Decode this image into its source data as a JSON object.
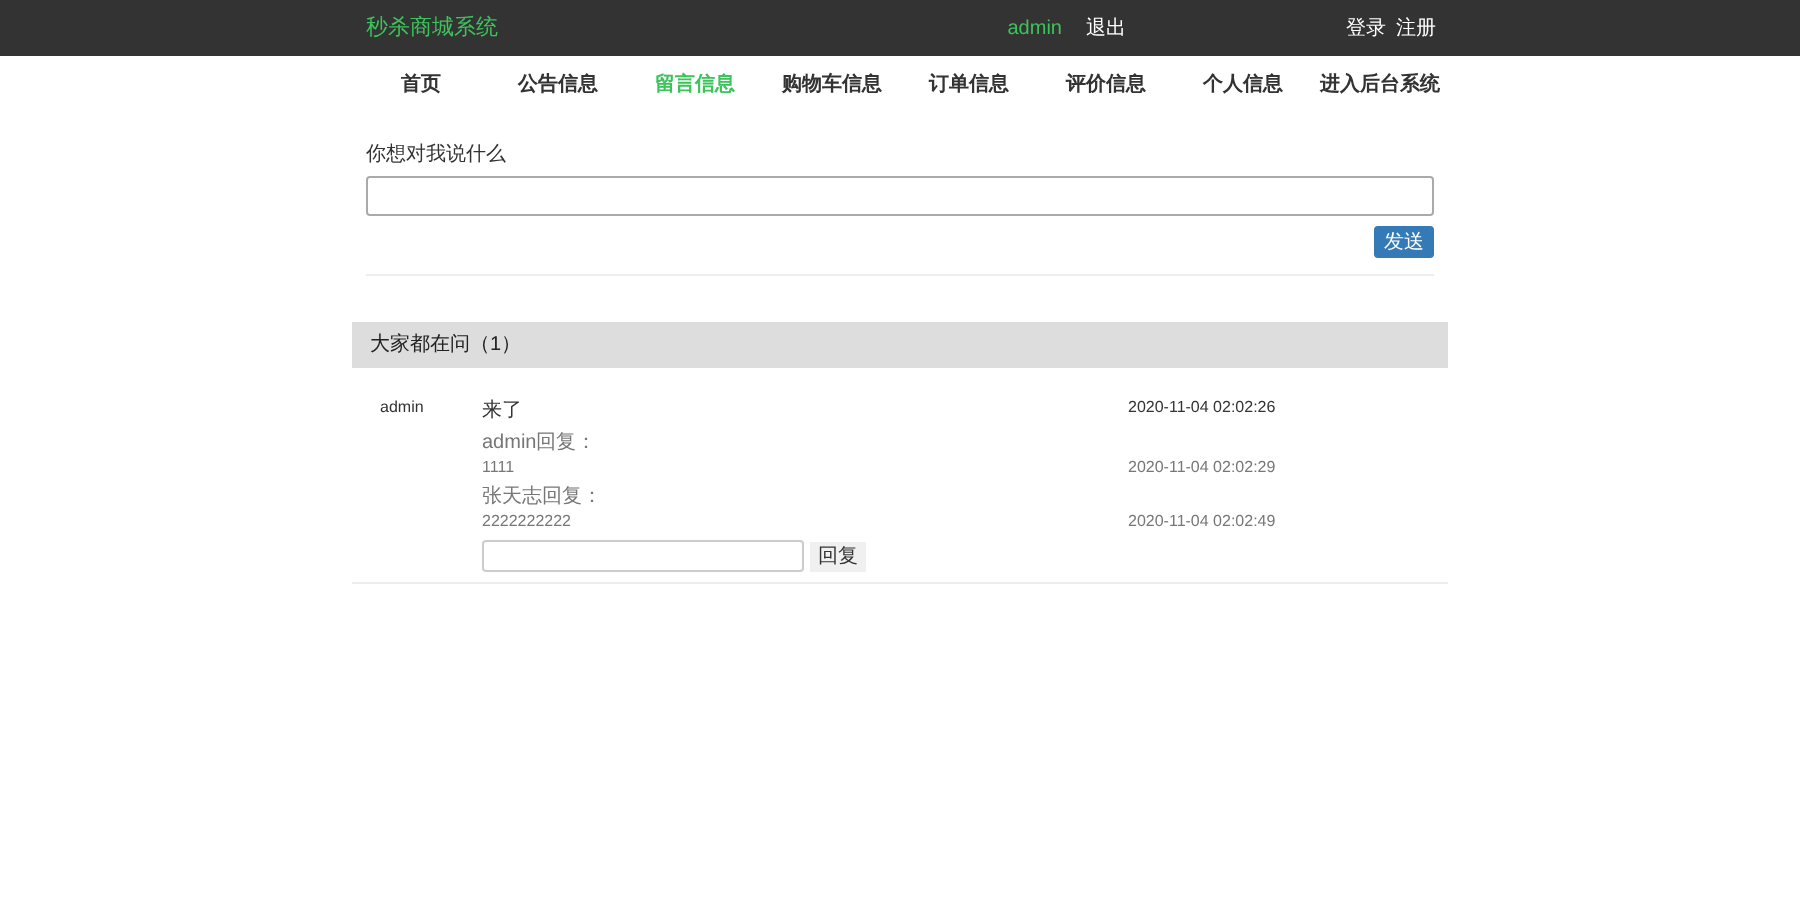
{
  "header": {
    "brand": "秒杀商城系统",
    "user": "admin",
    "logout": "退出",
    "login": "登录",
    "register": "注册"
  },
  "nav": [
    {
      "label": "首页",
      "selected": false
    },
    {
      "label": "公告信息",
      "selected": false
    },
    {
      "label": "留言信息",
      "selected": true
    },
    {
      "label": "购物车信息",
      "selected": false
    },
    {
      "label": "订单信息",
      "selected": false
    },
    {
      "label": "评价信息",
      "selected": false
    },
    {
      "label": "个人信息",
      "selected": false
    },
    {
      "label": "进入后台系统",
      "selected": false
    }
  ],
  "form": {
    "label": "你想对我说什么",
    "button": "发送"
  },
  "panel": {
    "title": "大家都在问（1）"
  },
  "messages": [
    {
      "author": "admin",
      "content": "来了",
      "time": "2020-11-04 02:02:26",
      "replies": [
        {
          "who": "admin回复：",
          "text": "1111",
          "time": "2020-11-04 02:02:29"
        },
        {
          "who": "张天志回复：",
          "text": "2222222222",
          "time": "2020-11-04 02:02:49"
        }
      ],
      "reply_button": "回复"
    }
  ]
}
